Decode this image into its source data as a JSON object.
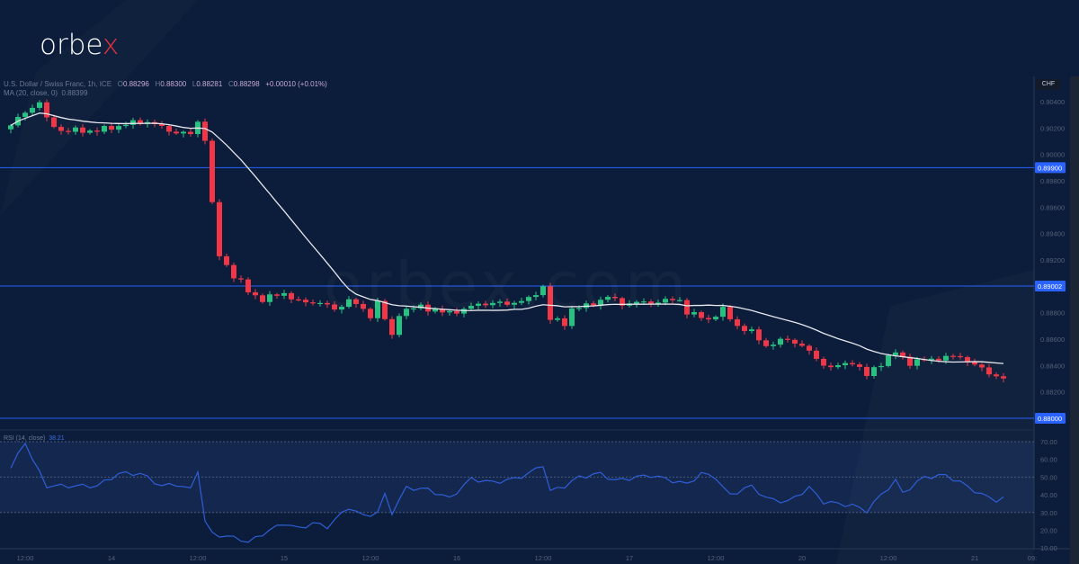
{
  "logo": {
    "text_main": "orbe",
    "text_accent": "x"
  },
  "watermark": "orbex.com",
  "legend": {
    "symbol": "U.S. Dollar / Swiss Franc, 1h, ICE",
    "o_label": "O",
    "o": "0.88296",
    "h_label": "H",
    "h": "0.88300",
    "l_label": "L",
    "l": "0.88281",
    "c_label": "C",
    "c": "0.88298",
    "change": "+0.00010 (+0.01%)",
    "ma_label": "MA (20, close, 0)",
    "ma_value": "0.88399"
  },
  "currency_label": "CHF",
  "rsi_legend": {
    "label": "RSI (14, close)",
    "value": "38.21"
  },
  "colors": {
    "background": "#0b1d3a",
    "up": "#26c281",
    "down": "#f23645",
    "ma": "#e8e8ee",
    "hline": "#2962ff",
    "rsi": "#2f5fd8"
  },
  "chart_data": {
    "type": "candlestick",
    "title": "U.S. Dollar / Swiss Franc, 1h, ICE",
    "price_axis": {
      "ylim": [
        0.879,
        0.905
      ],
      "ticks": [
        "0.90400",
        "0.90200",
        "0.90000",
        "0.89800",
        "0.89600",
        "0.89400",
        "0.89200",
        "0.88800",
        "0.88600",
        "0.88400",
        "0.88200"
      ]
    },
    "horizontal_levels": [
      {
        "value": 0.899,
        "label": "0.89900"
      },
      {
        "value": 0.89002,
        "label": "0.89002"
      },
      {
        "value": 0.88,
        "label": "0.88000"
      }
    ],
    "time_axis": [
      {
        "bar": 2,
        "label": "12:00"
      },
      {
        "bar": 14,
        "label": "14"
      },
      {
        "bar": 26,
        "label": "12:00"
      },
      {
        "bar": 38,
        "label": "15"
      },
      {
        "bar": 50,
        "label": "12:00"
      },
      {
        "bar": 62,
        "label": "16"
      },
      {
        "bar": 74,
        "label": "12:00"
      },
      {
        "bar": 86,
        "label": "17"
      },
      {
        "bar": 98,
        "label": "12:00"
      },
      {
        "bar": 110,
        "label": "20"
      },
      {
        "bar": 122,
        "label": "12:00"
      },
      {
        "bar": 134,
        "label": "21"
      },
      {
        "bar": 142,
        "label": "09:"
      }
    ],
    "close_keypoints": [
      [
        0,
        0.9022
      ],
      [
        2,
        0.9032
      ],
      [
        4,
        0.904
      ],
      [
        5,
        0.9026
      ],
      [
        7,
        0.9018
      ],
      [
        12,
        0.9018
      ],
      [
        17,
        0.9024
      ],
      [
        19,
        0.9025
      ],
      [
        22,
        0.9018
      ],
      [
        25,
        0.9015
      ],
      [
        26,
        0.9025
      ],
      [
        27,
        0.9012
      ],
      [
        28,
        0.8962
      ],
      [
        29,
        0.8923
      ],
      [
        30,
        0.8916
      ],
      [
        31,
        0.8908
      ],
      [
        32,
        0.8903
      ],
      [
        33,
        0.8896
      ],
      [
        35,
        0.889
      ],
      [
        38,
        0.8895
      ],
      [
        40,
        0.8888
      ],
      [
        43,
        0.8888
      ],
      [
        45,
        0.8882
      ],
      [
        47,
        0.889
      ],
      [
        49,
        0.8882
      ],
      [
        50,
        0.8878
      ],
      [
        51,
        0.8888
      ],
      [
        53,
        0.8862
      ],
      [
        54,
        0.888
      ],
      [
        57,
        0.8885
      ],
      [
        60,
        0.888
      ],
      [
        63,
        0.8882
      ],
      [
        65,
        0.8887
      ],
      [
        69,
        0.8887
      ],
      [
        72,
        0.889
      ],
      [
        74,
        0.89
      ],
      [
        75,
        0.8875
      ],
      [
        77,
        0.8872
      ],
      [
        78,
        0.8883
      ],
      [
        80,
        0.8885
      ],
      [
        83,
        0.8892
      ],
      [
        85,
        0.8887
      ],
      [
        89,
        0.8888
      ],
      [
        93,
        0.889
      ],
      [
        94,
        0.888
      ],
      [
        97,
        0.8875
      ],
      [
        99,
        0.8882
      ],
      [
        101,
        0.887
      ],
      [
        103,
        0.8865
      ],
      [
        105,
        0.8855
      ],
      [
        108,
        0.886
      ],
      [
        110,
        0.8855
      ],
      [
        112,
        0.8845
      ],
      [
        114,
        0.8838
      ],
      [
        117,
        0.8843
      ],
      [
        119,
        0.8832
      ],
      [
        120,
        0.8838
      ],
      [
        123,
        0.885
      ],
      [
        125,
        0.8842
      ],
      [
        128,
        0.8845
      ],
      [
        132,
        0.8847
      ],
      [
        134,
        0.884
      ],
      [
        137,
        0.8832
      ],
      [
        138,
        0.883
      ]
    ],
    "ma_period": 20,
    "rsi": {
      "ylim": [
        5,
        75
      ],
      "ticks": [
        "70.00",
        "60.00",
        "50.00",
        "40.00",
        "30.00",
        "20.00",
        "10.00"
      ],
      "levels": [
        70,
        50,
        30
      ],
      "keypoints": [
        [
          0,
          55
        ],
        [
          2,
          70
        ],
        [
          3,
          60
        ],
        [
          5,
          45
        ],
        [
          6,
          45
        ],
        [
          9,
          45
        ],
        [
          12,
          45
        ],
        [
          15,
          52
        ],
        [
          18,
          52
        ],
        [
          21,
          45
        ],
        [
          23,
          46
        ],
        [
          25,
          43
        ],
        [
          26,
          54
        ],
        [
          27,
          25
        ],
        [
          28,
          18
        ],
        [
          32,
          15
        ],
        [
          33,
          13
        ],
        [
          35,
          18
        ],
        [
          38,
          24
        ],
        [
          40,
          21
        ],
        [
          42,
          24
        ],
        [
          44,
          22
        ],
        [
          47,
          33
        ],
        [
          49,
          28
        ],
        [
          51,
          30
        ],
        [
          52,
          40
        ],
        [
          53,
          30
        ],
        [
          55,
          44
        ],
        [
          58,
          43
        ],
        [
          61,
          38
        ],
        [
          64,
          49
        ],
        [
          67,
          47
        ],
        [
          70,
          49
        ],
        [
          72,
          52
        ],
        [
          74,
          57
        ],
        [
          75,
          42
        ],
        [
          77,
          45
        ],
        [
          79,
          50
        ],
        [
          82,
          52
        ],
        [
          84,
          48
        ],
        [
          87,
          50
        ],
        [
          89,
          51
        ],
        [
          92,
          48
        ],
        [
          94,
          46
        ],
        [
          96,
          52
        ],
        [
          98,
          50
        ],
        [
          99,
          44
        ],
        [
          100,
          40
        ],
        [
          103,
          45
        ],
        [
          105,
          38
        ],
        [
          108,
          36
        ],
        [
          111,
          44
        ],
        [
          113,
          36
        ],
        [
          117,
          34
        ],
        [
          119,
          31
        ],
        [
          121,
          40
        ],
        [
          123,
          48
        ],
        [
          124,
          41
        ],
        [
          127,
          50
        ],
        [
          130,
          51
        ],
        [
          132,
          47
        ],
        [
          135,
          40
        ],
        [
          137,
          37
        ],
        [
          138,
          38
        ]
      ]
    }
  }
}
